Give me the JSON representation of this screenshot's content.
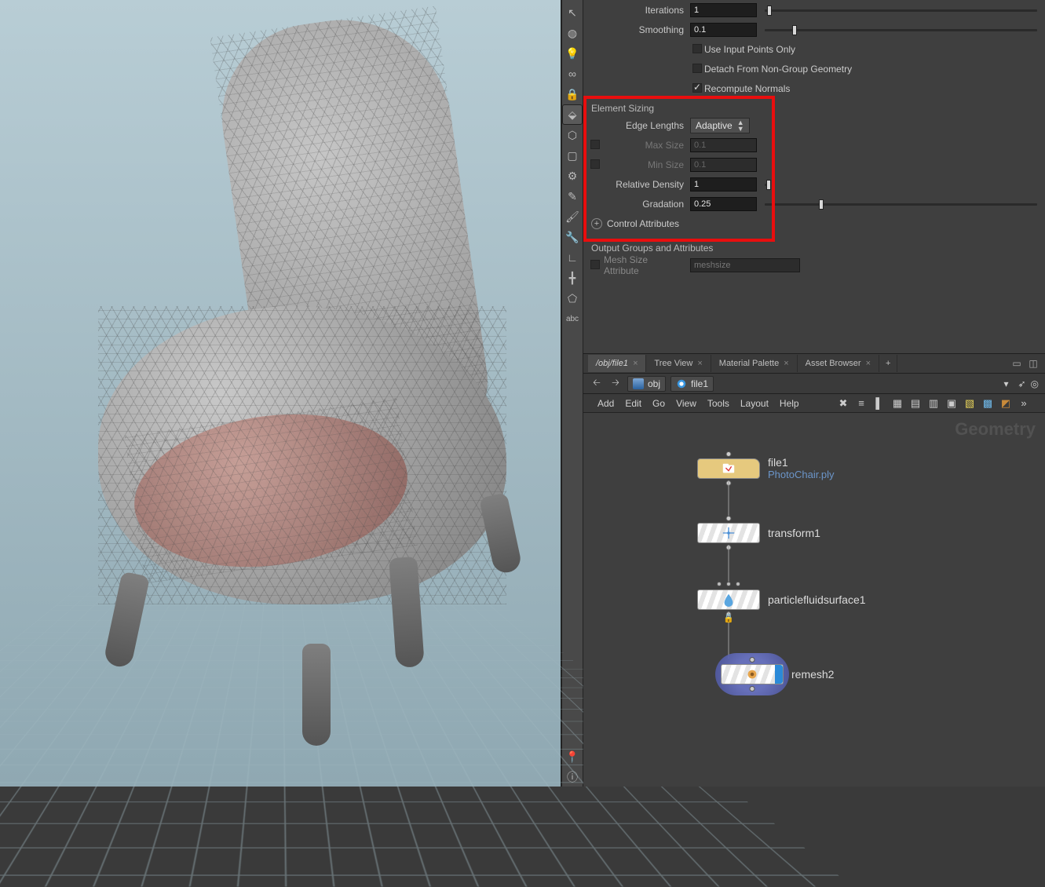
{
  "viewport": {
    "model": "chair-mesh"
  },
  "params": {
    "iterations": {
      "label": "Iterations",
      "value": "1"
    },
    "smoothing": {
      "label": "Smoothing",
      "value": "0.1"
    },
    "useInputPointsOnly": {
      "label": "Use Input Points Only",
      "checked": false
    },
    "detachNonGroup": {
      "label": "Detach From Non-Group Geometry",
      "checked": false
    },
    "recomputeNormals": {
      "label": "Recompute Normals",
      "checked": true
    },
    "elementSizing": {
      "title": "Element Sizing",
      "edgeLengths": {
        "label": "Edge Lengths",
        "value": "Adaptive"
      },
      "maxSize": {
        "label": "Max Size",
        "value": "0.1",
        "enabled": false
      },
      "minSize": {
        "label": "Min Size",
        "value": "0.1",
        "enabled": false
      },
      "relativeDensity": {
        "label": "Relative Density",
        "value": "1"
      },
      "gradation": {
        "label": "Gradation",
        "value": "0.25"
      },
      "controlAttributes": "Control Attributes"
    },
    "outputGroups": {
      "title": "Output Groups and Attributes",
      "meshSizeAttr": {
        "label": "Mesh Size Attribute",
        "value": "meshsize",
        "checked": false
      }
    }
  },
  "networkEditor": {
    "pathTab": "/obj/file1",
    "tabs": [
      "Tree View",
      "Material Palette",
      "Asset Browser"
    ],
    "navBack": "‹",
    "navFwd": "›",
    "breadcrumbs": {
      "obj": "obj",
      "file1": "file1"
    },
    "menu": [
      "Add",
      "Edit",
      "Go",
      "View",
      "Tools",
      "Layout",
      "Help"
    ],
    "watermark": "Geometry",
    "nodes": {
      "file1": {
        "label": "file1",
        "sub": "PhotoChair.ply"
      },
      "transform1": {
        "label": "transform1"
      },
      "particlefluidsurface1": {
        "label": "particlefluidsurface1"
      },
      "remesh2": {
        "label": "remesh2"
      }
    }
  },
  "toolbarIcons": [
    "move",
    "rotate",
    "scale",
    "light",
    "link",
    "lock",
    "magnet",
    "grid",
    "box",
    "curve",
    "pen",
    "brush",
    "measure",
    "axis",
    "polygon",
    "text",
    "pin"
  ]
}
